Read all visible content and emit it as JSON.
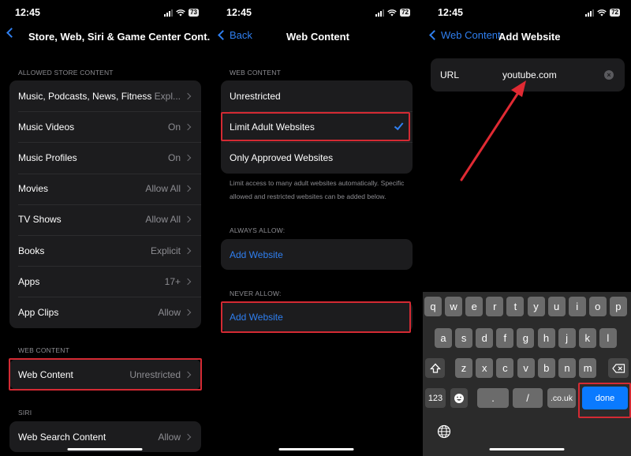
{
  "status": {
    "time": "12:45",
    "battery_panel1": "73",
    "battery_panel2": "72",
    "battery_panel3": "72"
  },
  "panel1": {
    "title": "Store, Web, Siri & Game Center Cont...",
    "sections": {
      "allowed_store_content": {
        "header": "ALLOWED STORE CONTENT",
        "rows": [
          {
            "label": "Music, Podcasts, News, Fitness",
            "value": "Expl..."
          },
          {
            "label": "Music Videos",
            "value": "On"
          },
          {
            "label": "Music Profiles",
            "value": "On"
          },
          {
            "label": "Movies",
            "value": "Allow All"
          },
          {
            "label": "TV Shows",
            "value": "Allow All"
          },
          {
            "label": "Books",
            "value": "Explicit"
          },
          {
            "label": "Apps",
            "value": "17+"
          },
          {
            "label": "App Clips",
            "value": "Allow"
          }
        ]
      },
      "web_content": {
        "header": "WEB CONTENT",
        "rows": [
          {
            "label": "Web Content",
            "value": "Unrestricted"
          }
        ]
      },
      "siri": {
        "header": "SIRI",
        "rows": [
          {
            "label": "Web Search Content",
            "value": "Allow"
          }
        ]
      }
    }
  },
  "panel2": {
    "back_label": "Back",
    "title": "Web Content",
    "section_header": "WEB CONTENT",
    "options": [
      {
        "label": "Unrestricted",
        "selected": false
      },
      {
        "label": "Limit Adult Websites",
        "selected": true
      },
      {
        "label": "Only Approved Websites",
        "selected": false
      }
    ],
    "footnote": "Limit access to many adult websites automatically. Specific allowed and restricted websites can be added below.",
    "always_allow": {
      "header": "ALWAYS ALLOW:",
      "action": "Add Website"
    },
    "never_allow": {
      "header": "NEVER ALLOW:",
      "action": "Add Website"
    }
  },
  "panel3": {
    "back_label": "Web Content",
    "title": "Add Website",
    "url_label": "URL",
    "url_value": "youtube.com",
    "keyboard": {
      "row1": [
        "q",
        "w",
        "e",
        "r",
        "t",
        "y",
        "u",
        "i",
        "o",
        "p"
      ],
      "row2": [
        "a",
        "s",
        "d",
        "f",
        "g",
        "h",
        "j",
        "k",
        "l"
      ],
      "row3": [
        "z",
        "x",
        "c",
        "v",
        "b",
        "n",
        "m"
      ],
      "numbers_key": "123",
      "dot_key": ".",
      "slash_key": "/",
      "domain_key": ".co.uk",
      "done_key": "done"
    }
  },
  "colors": {
    "accent": "#2f7ff0",
    "highlight": "#d42a33",
    "done_key": "#0a7aff"
  }
}
